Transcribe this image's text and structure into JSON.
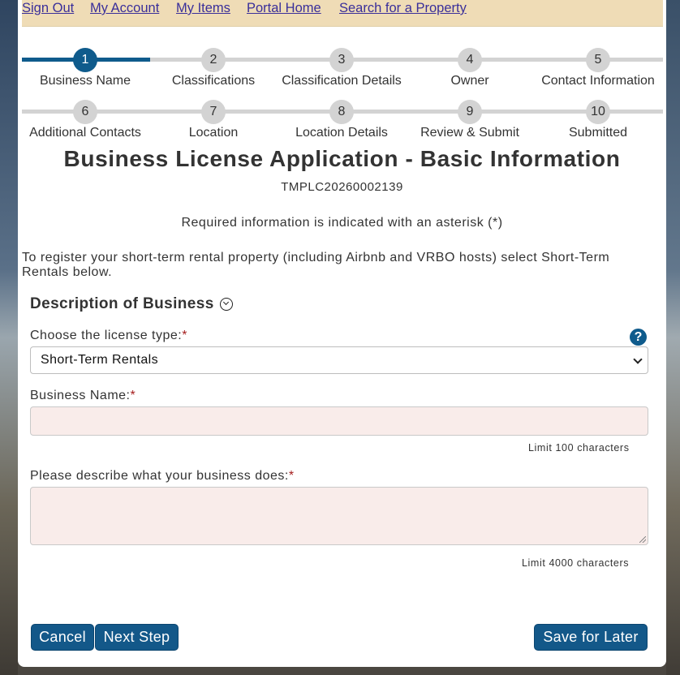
{
  "topnav": {
    "links": [
      "Sign Out",
      "My Account",
      "My Items",
      "Portal Home",
      "Search for a Property"
    ]
  },
  "steps": [
    {
      "number": "1",
      "label": "Business Name"
    },
    {
      "number": "2",
      "label": "Classifications"
    },
    {
      "number": "3",
      "label": "Classification Details"
    },
    {
      "number": "4",
      "label": "Owner"
    },
    {
      "number": "5",
      "label": "Contact Information"
    },
    {
      "number": "6",
      "label": "Additional Contacts"
    },
    {
      "number": "7",
      "label": "Location"
    },
    {
      "number": "8",
      "label": "Location Details"
    },
    {
      "number": "9",
      "label": "Review & Submit"
    },
    {
      "number": "10",
      "label": "Submitted"
    }
  ],
  "current_step": 1,
  "page": {
    "title": "Business License Application - Basic Information",
    "application_id": "TMPLC20260002139",
    "required_note": "Required information is indicated with an asterisk (*)",
    "intro": "To register your short-term rental property (including Airbnb and VRBO hosts) select Short-Term Rentals below."
  },
  "section": {
    "title": "Description of Business"
  },
  "form": {
    "license_type": {
      "label": "Choose the license type:",
      "required_mark": "*",
      "value": "Short-Term Rentals",
      "help_icon": "?"
    },
    "business_name": {
      "label": "Business Name:",
      "required_mark": "*",
      "value": "",
      "limit": "Limit 100 characters"
    },
    "description": {
      "label": "Please describe what your business does:",
      "required_mark": "*",
      "value": "",
      "limit": "Limit 4000 characters"
    }
  },
  "buttons": {
    "cancel": "Cancel",
    "next": "Next Step",
    "save": "Save for Later"
  },
  "colors": {
    "accent": "#0f5b8c",
    "nav_background": "#efdcb6",
    "input_background": "#f9ecea",
    "required": "#a51d1d"
  }
}
